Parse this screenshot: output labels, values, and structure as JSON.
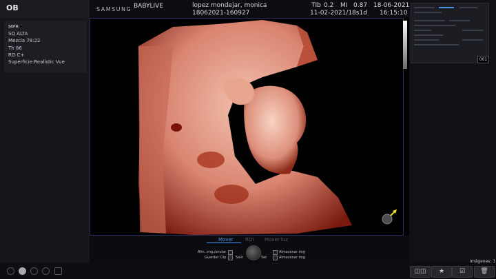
{
  "header": {
    "exam_type": "OB",
    "brand": "SAMSUNG",
    "mode": "BABYLIVE",
    "patient_name": "lopez mondejar, monica",
    "patient_id": "18062021-160927",
    "tib_label": "TIb",
    "tib_value": "0.2",
    "mi_label": "MI",
    "mi_value": "0.87",
    "ga": "11-02-2021/18s1d",
    "date": "18-06-2021",
    "time": "16:15:10"
  },
  "params": [
    "MPR",
    "SQ ALTA",
    "Mezcla 78:22",
    "Th 86",
    "RD C+",
    "Superficie:Realistic Vue"
  ],
  "right_panel": {
    "image_count": "001"
  },
  "controls": {
    "tabs": [
      "Mover",
      "ROI",
      "Mover luz"
    ],
    "active_tab": "Mover",
    "left_options": [
      "Alm. img./enviar",
      "Guardar Clip"
    ],
    "right_options": [
      "Almacenar img",
      "Almacenar img"
    ],
    "knob_left": "Salir",
    "knob_right": "Set"
  },
  "status": {
    "images": "Imágenes: 1"
  },
  "colors": {
    "accent": "#4e8fe8",
    "render_flesh": "#e8a68c",
    "render_shadow": "#8a1d10"
  },
  "icons": [
    "scan-icon",
    "dot-icon",
    "settings-icon",
    "clip-icon",
    "screen-icon",
    "dual-layout-icon",
    "star-icon",
    "checkbox-icon",
    "trash-icon",
    "arrow-marker-icon"
  ]
}
